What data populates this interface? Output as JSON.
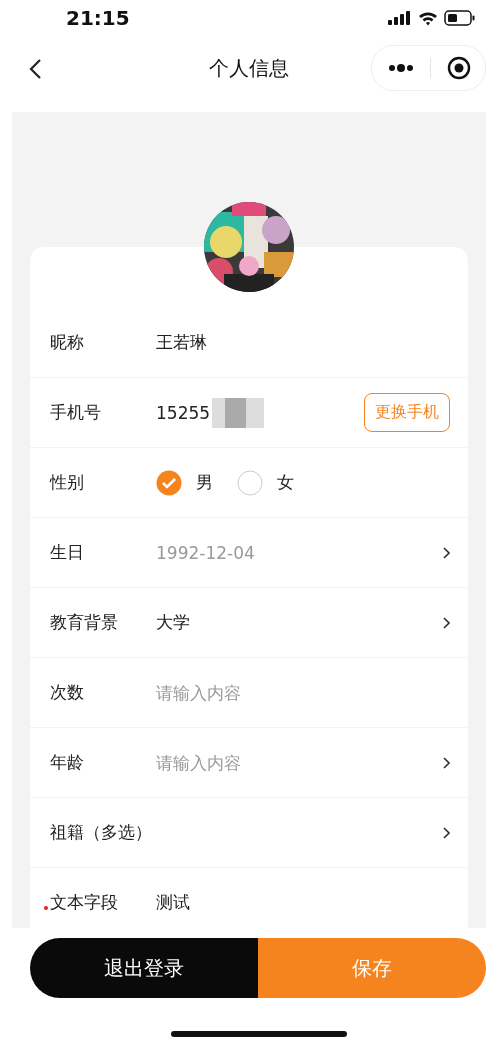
{
  "status_bar": {
    "time": "21:15"
  },
  "nav": {
    "title": "个人信息"
  },
  "rows": [
    {
      "kind": "text",
      "label": "昵称",
      "value": "王若琳",
      "chevron": false,
      "required": false
    },
    {
      "kind": "phone",
      "label": "手机号",
      "value": "15255",
      "button": "更换手机",
      "chevron": false,
      "required": false
    },
    {
      "kind": "radio",
      "label": "性别",
      "options": [
        {
          "label": "男",
          "selected": true
        },
        {
          "label": "女",
          "selected": false
        }
      ],
      "chevron": false,
      "required": false
    },
    {
      "kind": "text",
      "label": "生日",
      "value": "1992-12-04",
      "disabled": true,
      "chevron": true,
      "required": false
    },
    {
      "kind": "text",
      "label": "教育背景",
      "value": "大学",
      "disabled": false,
      "chevron": true,
      "required": false
    },
    {
      "kind": "input",
      "label": "次数",
      "placeholder": "请输入内容",
      "chevron": false,
      "required": false
    },
    {
      "kind": "input",
      "label": "年龄",
      "placeholder": "请输入内容",
      "chevron": true,
      "required": false
    },
    {
      "kind": "text",
      "label": "祖籍（多选）",
      "chevron": true,
      "required": false
    },
    {
      "kind": "text",
      "label": "文本字段",
      "value": "测试",
      "chevron": false,
      "required": true
    }
  ],
  "buttons": {
    "logout": "退出登录",
    "save": "保存"
  }
}
